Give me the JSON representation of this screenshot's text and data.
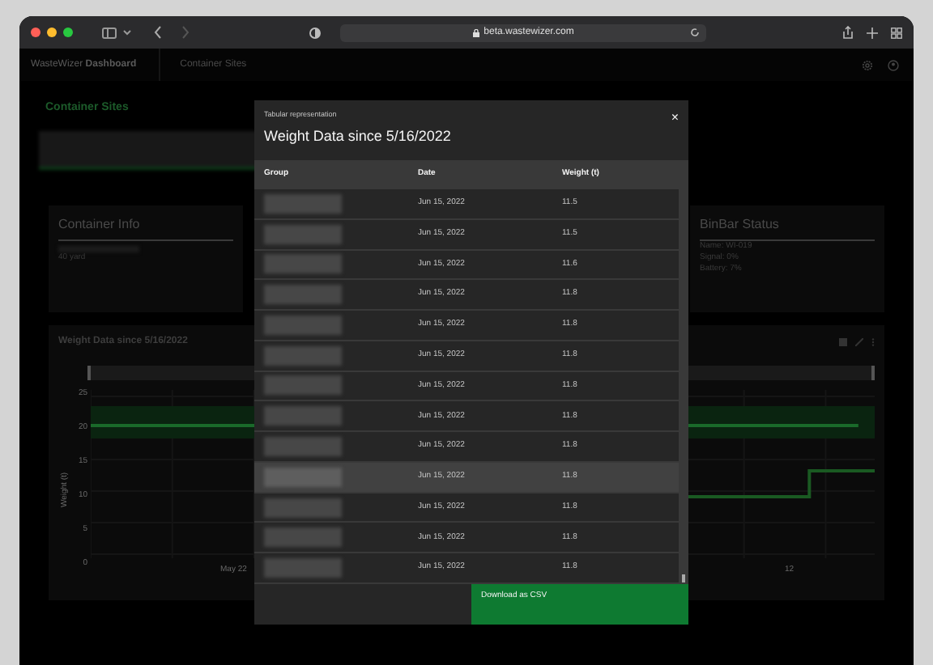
{
  "browser": {
    "url": "beta.wastewizer.com"
  },
  "header": {
    "brand_light": "WasteWizer",
    "brand_bold": "Dashboard",
    "nav": "Container Sites"
  },
  "page": {
    "title": "Container Sites"
  },
  "container_info": {
    "title": "Container Info",
    "size": "40 yard"
  },
  "binbar_status": {
    "title": "BinBar Status",
    "lines": [
      "Name: WI-019",
      "Signal: 0%",
      "Battery: 7%"
    ]
  },
  "chart": {
    "title": "Weight Data since 5/16/2022",
    "ylabel": "Weight (t)",
    "yticks": [
      "25",
      "20",
      "15",
      "10",
      "5",
      "0"
    ],
    "xticks": [
      "May 22",
      "12"
    ],
    "range_slider": {
      "level": 1
    }
  },
  "modal": {
    "subtitle": "Tabular representation",
    "close": "×",
    "title": "Weight Data since 5/16/2022",
    "columns": [
      "Group",
      "Date",
      "Weight (t)"
    ],
    "rows": [
      {
        "date": "Jun 15, 2022",
        "weight": "11.5",
        "selected": false
      },
      {
        "date": "Jun 15, 2022",
        "weight": "11.5",
        "selected": false
      },
      {
        "date": "Jun 15, 2022",
        "weight": "11.6",
        "selected": false
      },
      {
        "date": "Jun 15, 2022",
        "weight": "11.8",
        "selected": false
      },
      {
        "date": "Jun 15, 2022",
        "weight": "11.8",
        "selected": false
      },
      {
        "date": "Jun 15, 2022",
        "weight": "11.8",
        "selected": false
      },
      {
        "date": "Jun 15, 2022",
        "weight": "11.8",
        "selected": false
      },
      {
        "date": "Jun 15, 2022",
        "weight": "11.8",
        "selected": false
      },
      {
        "date": "Jun 15, 2022",
        "weight": "11.8",
        "selected": false
      },
      {
        "date": "Jun 15, 2022",
        "weight": "11.8",
        "selected": true
      },
      {
        "date": "Jun 15, 2022",
        "weight": "11.8",
        "selected": false
      },
      {
        "date": "Jun 15, 2022",
        "weight": "11.8",
        "selected": false
      },
      {
        "date": "Jun 15, 2022",
        "weight": "11.8",
        "selected": false
      }
    ],
    "download_button": "Download as CSV"
  }
}
